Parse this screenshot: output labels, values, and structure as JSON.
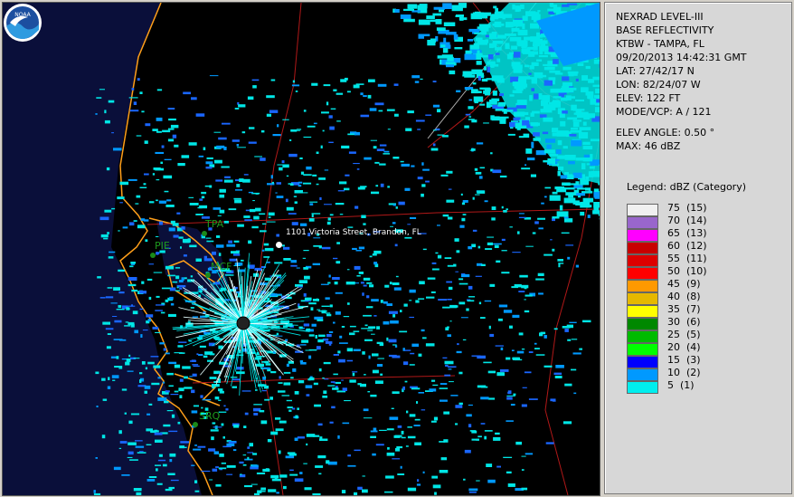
{
  "info": {
    "product": "NEXRAD LEVEL-III",
    "type": "BASE REFLECTIVITY",
    "station": "KTBW - TAMPA, FL",
    "datetime": "09/20/2013 14:42:31 GMT",
    "lat": "LAT: 27/42/17 N",
    "lon": "LON: 82/24/07 W",
    "elev": "ELEV: 122 FT",
    "mode": "MODE/VCP: A / 121",
    "elev_angle": "ELEV ANGLE: 0.50 °",
    "max": "MAX: 46 dBZ"
  },
  "legend": {
    "title": "Legend: dBZ (Category)",
    "items": [
      {
        "label": "75  (15)",
        "color": "#f0f0f0"
      },
      {
        "label": "70  (14)",
        "color": "#9966cc"
      },
      {
        "label": "65  (13)",
        "color": "#ff00ff"
      },
      {
        "label": "60  (12)",
        "color": "#c80000"
      },
      {
        "label": "55  (11)",
        "color": "#dd0000"
      },
      {
        "label": "50  (10)",
        "color": "#ff0000"
      },
      {
        "label": "45  (9)",
        "color": "#ff9900"
      },
      {
        "label": "40  (8)",
        "color": "#e6b800"
      },
      {
        "label": "35  (7)",
        "color": "#ffff00"
      },
      {
        "label": "30  (6)",
        "color": "#008800"
      },
      {
        "label": "25  (5)",
        "color": "#00bb00"
      },
      {
        "label": "20  (4)",
        "color": "#00ff00"
      },
      {
        "label": "15  (3)",
        "color": "#0000ff"
      },
      {
        "label": "10  (2)",
        "color": "#0099ff"
      },
      {
        "label": "5  (1)",
        "color": "#00eeee"
      }
    ]
  },
  "map": {
    "cities": [
      "TPA",
      "PIE",
      "MCF",
      "SRQ"
    ],
    "address": "1101 Victoria Street, Brandon, FL",
    "logo": "NOAA"
  }
}
